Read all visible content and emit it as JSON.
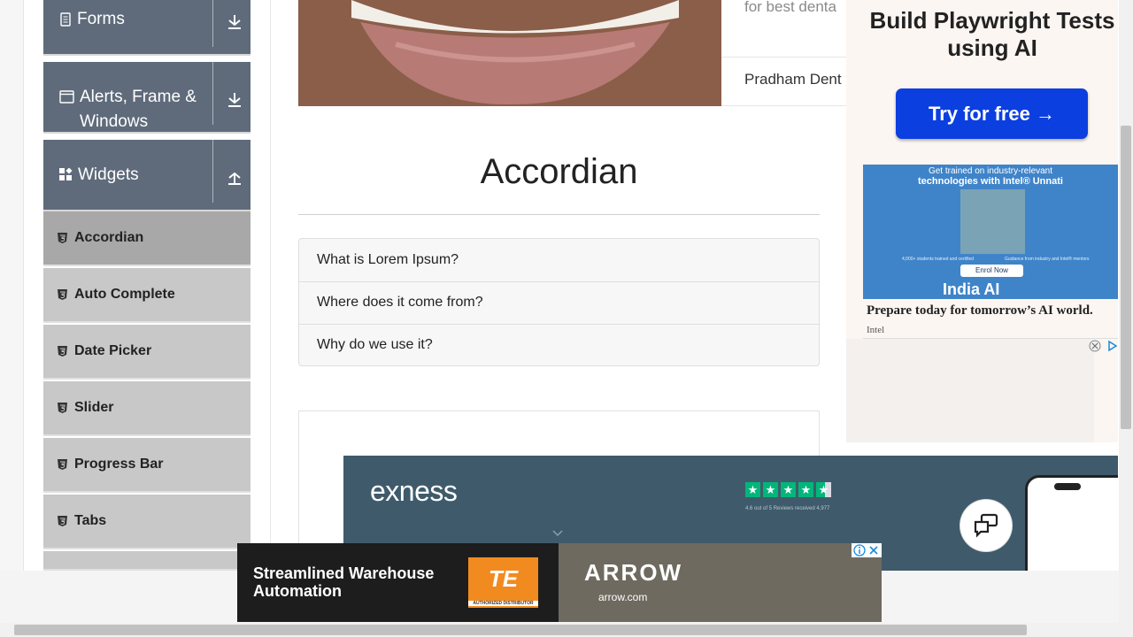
{
  "sidebar": {
    "groups": [
      {
        "label": "Forms",
        "icon": "document-icon",
        "arrow": "download-icon"
      },
      {
        "label": "Alerts, Frame &",
        "label2": "Windows",
        "icon": "window-icon",
        "arrow": "download-icon"
      },
      {
        "label": "Widgets",
        "icon": "widgets-icon",
        "arrow": "upload-icon"
      }
    ],
    "items": [
      {
        "label": "Accordian",
        "active": true
      },
      {
        "label": "Auto Complete"
      },
      {
        "label": "Date Picker"
      },
      {
        "label": "Slider"
      },
      {
        "label": "Progress Bar"
      },
      {
        "label": "Tabs"
      }
    ]
  },
  "top_card": {
    "description": "for best denta",
    "footer": "Pradham Dent"
  },
  "main": {
    "title": "Accordian",
    "accordion": [
      {
        "label": "What is Lorem Ipsum?"
      },
      {
        "label": "Where does it come from?"
      },
      {
        "label": "Why do we use it?"
      }
    ]
  },
  "ads": {
    "playwright": {
      "title": "Build Playwright Tests using AI",
      "button": "Try for free →"
    },
    "intel": {
      "line1": "Get trained on industry-relevant",
      "line2": "technologies with Intel® Unnati",
      "small1": "4,000+ students trained and certified",
      "small2": "Guidance from industry and Intel® mentors",
      "enrol": "Enrol Now",
      "india": "India AI",
      "headline": "Prepare today for tomorrow’s AI world.",
      "source": "Intel"
    },
    "exness": {
      "logo": "exness",
      "rating": "4.6 out of 5 Reviews received 4,977"
    },
    "bottom": {
      "line1": "Streamlined Warehouse",
      "line2": "Automation",
      "te": "TE",
      "te_sub": "AUTHORIZED DISTRIBUTOR",
      "arrow_logo": "ARROW",
      "arrow_url": "arrow.com"
    }
  },
  "colors": {
    "sidebar_group": "#5f6b7b",
    "subitem": "#c8c8c8",
    "subitem_active": "#a8a8a8",
    "cta_blue": "#0b3fe0",
    "trustpilot": "#00b67a"
  }
}
